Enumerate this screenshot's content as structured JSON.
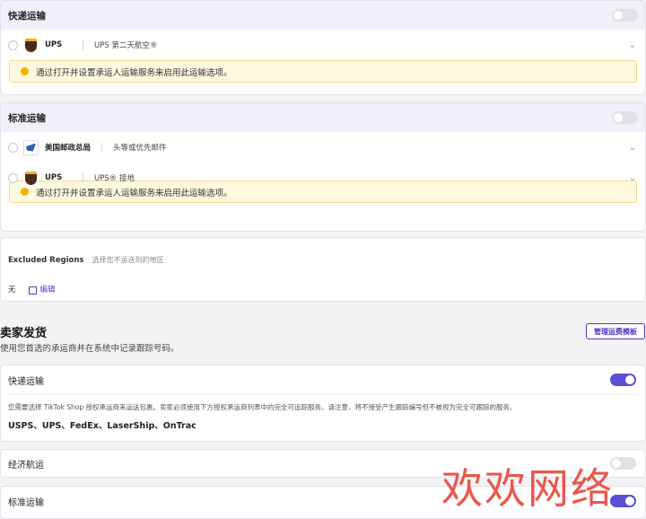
{
  "express_card": {
    "title": "快递运输",
    "rows": [
      {
        "carrier": "UPS",
        "service": "UPS 第二天航空®"
      }
    ],
    "warning": "通过打开并设置承运人运输服务来启用此运输选项。"
  },
  "standard_card": {
    "title": "标准运输",
    "rows": [
      {
        "carrier": "美国邮政总局",
        "service": "头等或优先邮件"
      },
      {
        "carrier": "UPS",
        "service": "UPS® 接地"
      }
    ],
    "warning": "通过打开并设置承运人运输服务来启用此运输选项。"
  },
  "excluded": {
    "title": "Excluded Regions",
    "hint": "选择您不运送到的地区",
    "value": "无",
    "edit_label": "编辑"
  },
  "seller_ship": {
    "title": "卖家发货",
    "subtitle": "使用您首选的承运商并在系统中记录跟踪号码。",
    "manage_button": "管理运费模板",
    "express": {
      "title": "快递运输",
      "enabled": true,
      "note": "您需要选择 TikTok Shop 授权承运商来运送包裹。卖家必须使用下方授权承运商列表中的完全可追踪服务。请注意，将不接受产生跟踪编号但不被视为完全可跟踪的服务。",
      "carriers": "USPS、UPS、FedEx、LaserShip、OnTrac"
    },
    "economy": {
      "title": "经济航运",
      "enabled": false
    },
    "standard": {
      "title": "标准运输",
      "enabled": true
    }
  },
  "watermark": "欢欢网络",
  "colors": {
    "accent": "#5b4fd6",
    "warning_bg": "#fef8de",
    "header_bg": "#f0effa"
  },
  "icons": {
    "ups": "ups-logo-icon",
    "usps": "usps-logo-icon",
    "warning": "warning-dot-icon",
    "edit": "edit-icon",
    "chevron": "chevron-down-icon"
  }
}
